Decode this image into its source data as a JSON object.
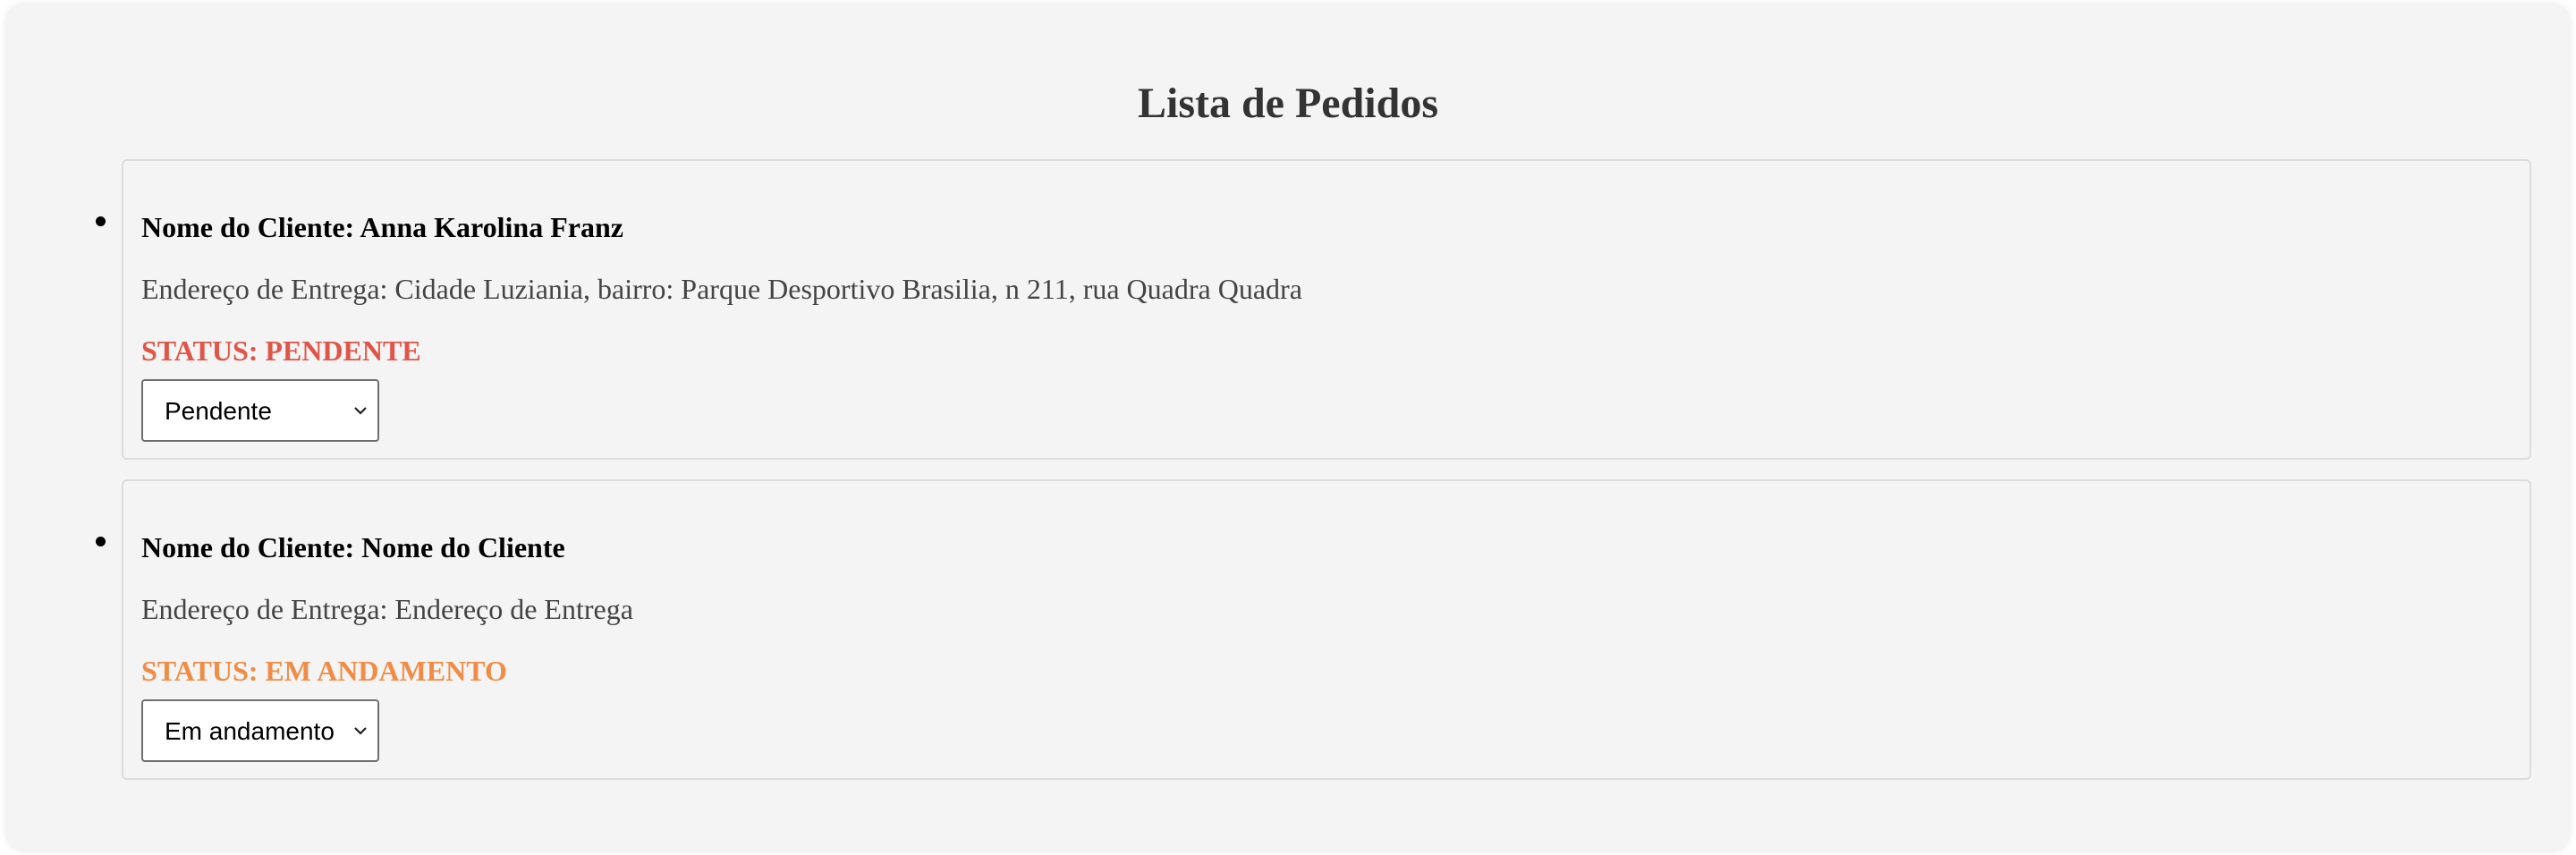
{
  "page": {
    "title": "Lista de Pedidos"
  },
  "orders": [
    {
      "client_label": "Nome do Cliente: Anna Karolina Franz",
      "address_label": "Endereço de Entrega: Cidade Luziania, bairro: Parque Desportivo Brasilia, n 211, rua Quadra Quadra",
      "status_label": "STATUS: PENDENTE",
      "status_color": "#e05548",
      "selected_option": "Pendente"
    },
    {
      "client_label": "Nome do Cliente: Nome do Cliente",
      "address_label": "Endereço de Entrega: Endereço de Entrega",
      "status_label": "STATUS: EM ANDAMENTO",
      "status_color": "#f08c45",
      "selected_option": "Em andamento"
    }
  ],
  "icons": {
    "select_arrow": "chevron-down-icon"
  }
}
